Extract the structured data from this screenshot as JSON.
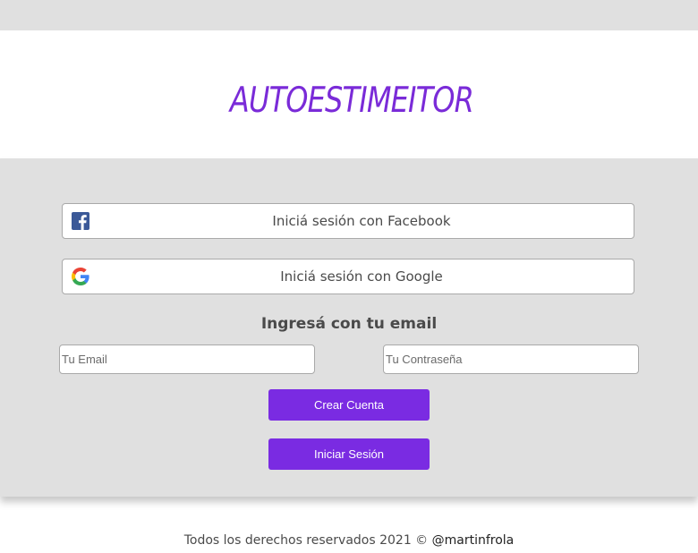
{
  "header": {
    "title": "AUTOESTIMEITOR"
  },
  "social": {
    "facebook_label": "Iniciá sesión con Facebook",
    "google_label": "Iniciá sesión con Google"
  },
  "email_section": {
    "heading": "Ingresá con tu email",
    "email_placeholder": "Tu Email",
    "password_placeholder": "Tu Contraseña"
  },
  "actions": {
    "create_label": "Crear Cuenta",
    "login_label": "Iniciar Sesión"
  },
  "footer": {
    "text": "Todos los derechos reservados 2021 © ",
    "author": "@martinfrola"
  },
  "colors": {
    "accent": "#7a2be2",
    "title": "#7a2bd8",
    "panel": "#e0e0e0",
    "facebook": "#3b5998"
  },
  "icons": {
    "facebook": "facebook-icon",
    "google": "google-icon"
  }
}
